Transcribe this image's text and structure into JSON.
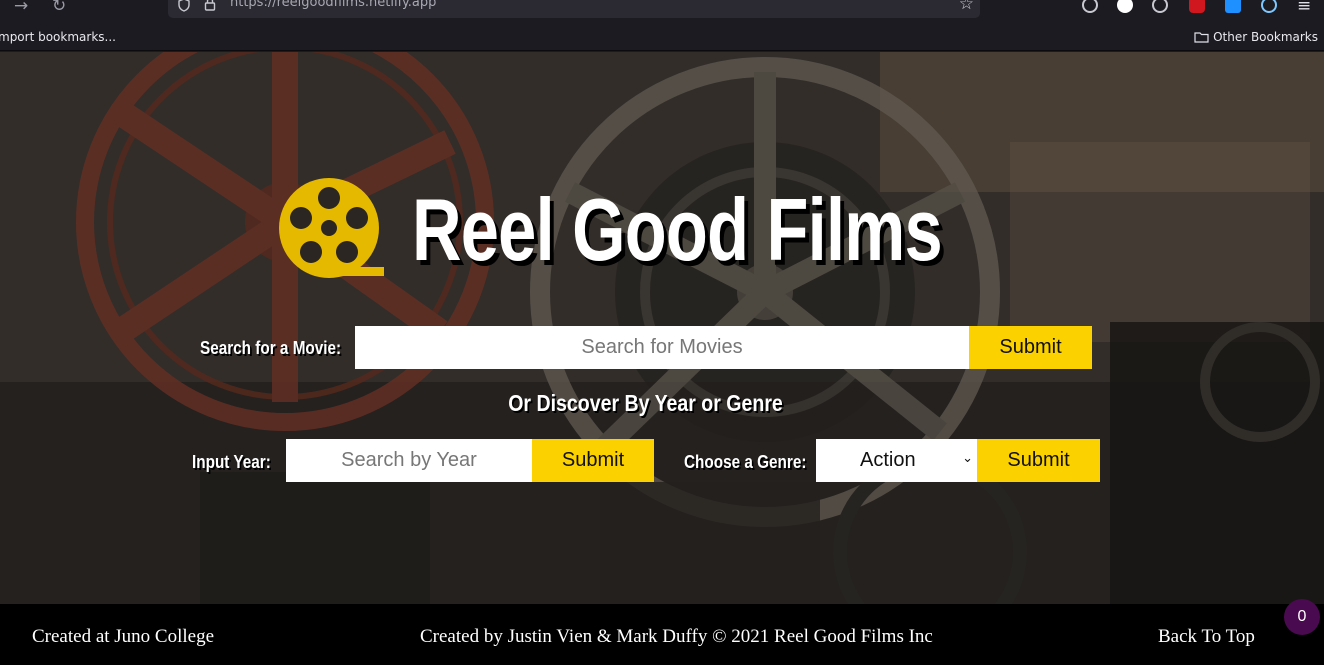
{
  "browser": {
    "url": "https://reelgoodfilms.netlify.app",
    "bookmarks_left": "mport bookmarks...",
    "bookmarks_right": "Other Bookmarks"
  },
  "brand": {
    "title": "Reel Good Films",
    "logo_icon": "film-reel-icon",
    "accent_color": "#fbd100"
  },
  "search": {
    "label": "Search for a Movie:",
    "placeholder": "Search for Movies",
    "submit": "Submit"
  },
  "discover": {
    "heading": "Or Discover By Year or Genre",
    "year_label": "Input Year:",
    "year_placeholder": "Search by Year",
    "year_submit": "Submit",
    "genre_label": "Choose a Genre:",
    "genre_selected": "Action",
    "genre_submit": "Submit"
  },
  "footer": {
    "left": "Created at Juno College",
    "center": "Created by Justin Vien & Mark Duffy © 2021 Reel Good Films Inc",
    "right": "Back To Top"
  },
  "counter_badge": "0"
}
